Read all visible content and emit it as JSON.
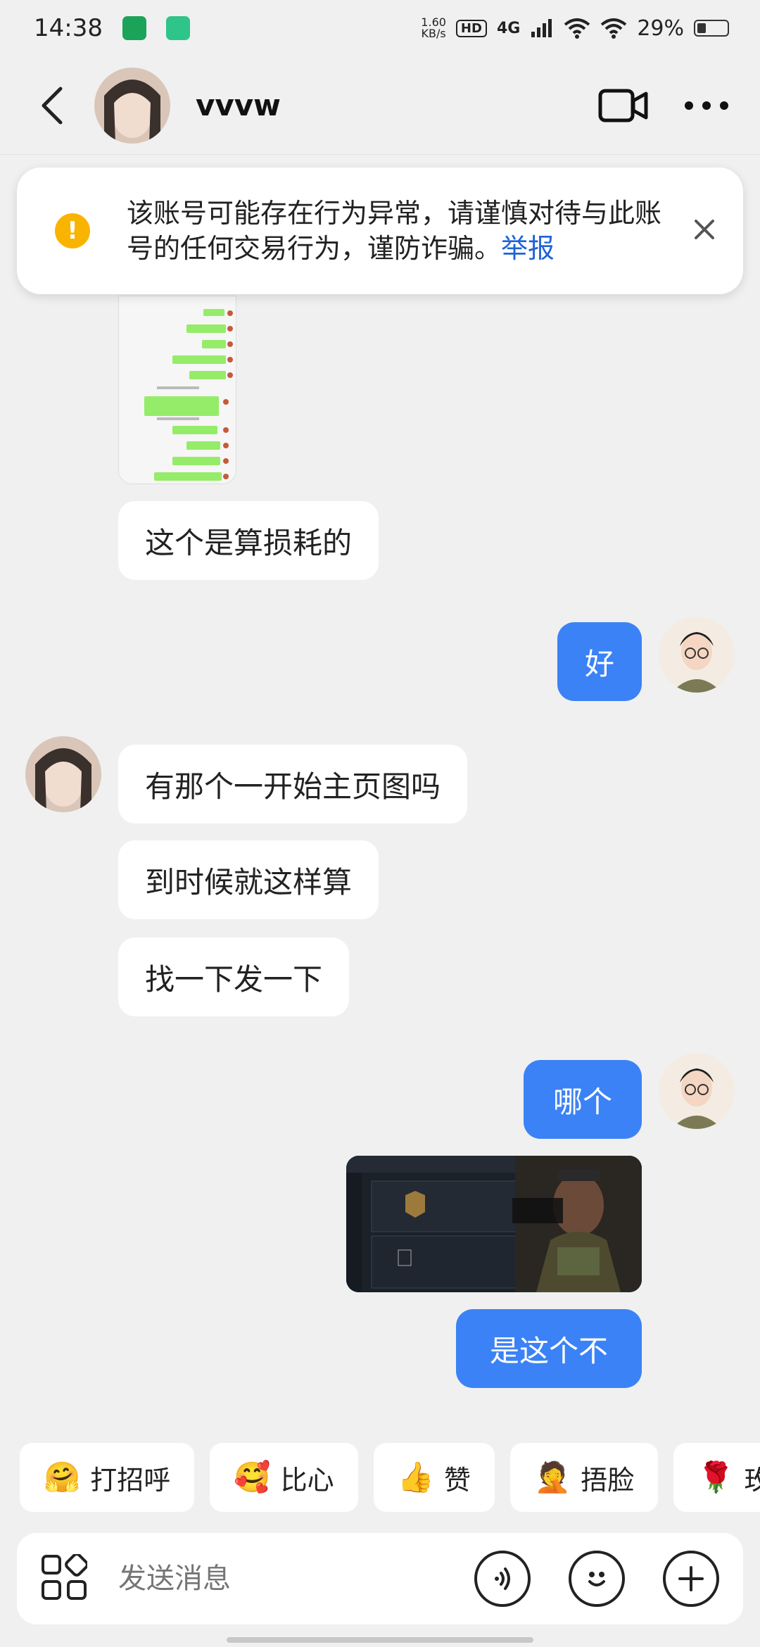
{
  "status_bar": {
    "time": "14:38",
    "net_speed_value": "1.60",
    "net_speed_unit": "KB/s",
    "hd": "HD",
    "network": "4G",
    "battery": "29%",
    "battery_level": 0.29
  },
  "header": {
    "contact_name": "vvvw"
  },
  "warning": {
    "text": "该账号可能存在行为异常，请谨慎对待与此账号的任何交易行为，谨防诈骗。",
    "link": "举报"
  },
  "messages": {
    "m1": "这个是算损耗的",
    "m2": "好",
    "m3": "有那个一开始主页图吗",
    "m4": "到时候就这样算",
    "m5": "找一下发一下",
    "m6": "哪个",
    "m7": "是这个不"
  },
  "quick_replies": [
    {
      "emoji": "🤗",
      "label": "打招呼"
    },
    {
      "emoji": "🥰",
      "label": "比心"
    },
    {
      "emoji": "👍",
      "label": "赞"
    },
    {
      "emoji": "🤦",
      "label": "捂脸"
    },
    {
      "emoji": "🌹",
      "label": "玫"
    }
  ],
  "input": {
    "placeholder": "发送消息"
  },
  "colors": {
    "outgoing_bubble": "#3B82F6",
    "link": "#1E63D6",
    "warning": "#F8B400"
  },
  "icons": {
    "back": "back-icon",
    "video": "video-call-icon",
    "more": "more-icon",
    "apps": "apps-grid-icon",
    "voice": "voice-icon",
    "emoji": "emoji-icon",
    "add": "add-icon",
    "close": "close-icon"
  }
}
